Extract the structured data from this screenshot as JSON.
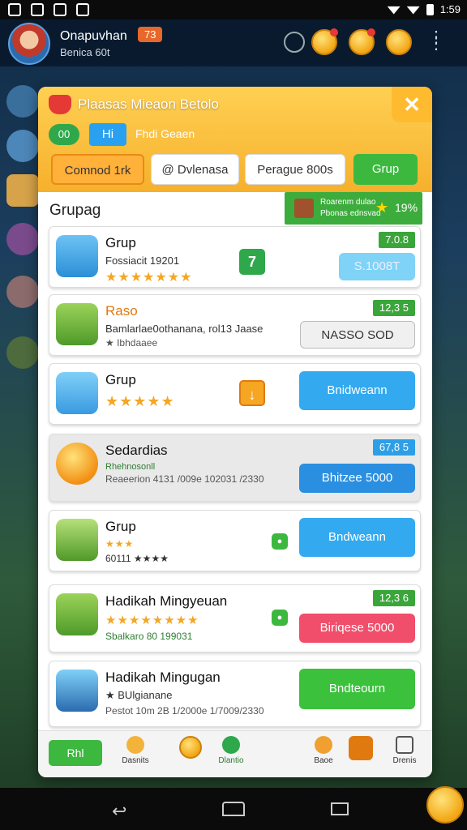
{
  "status_bar": {
    "time": "1:59"
  },
  "profile": {
    "name": "Onapuvhan",
    "level": "73",
    "subtitle": "Benica 60t"
  },
  "modal": {
    "title": "Plaasas Mieaon Betolo",
    "close_label": "✕",
    "pill_green": "00",
    "pill_blue": "Hi",
    "subtitle": "Fhdi Geaen",
    "tabs": [
      "Comnod 1rk",
      "@ Dvlenasa",
      "Perague 800s",
      "Grup"
    ],
    "section_title": "Grupag",
    "promo": {
      "line1": "Roarenm dulao",
      "line2": "Pbonas ednsvad",
      "value": "19%"
    }
  },
  "rows": [
    {
      "title": "Grup",
      "line1": "Fossiacit 19201",
      "line2": "★★★★★★★",
      "value": "7.0.8",
      "badge": "7",
      "button": "S.1008T"
    },
    {
      "title": "Raso",
      "line1": "Bamlarlae0othanana, rol13 Jaase",
      "line2": "★ Ibhdaaee",
      "value": "12,3 5",
      "button": "NASSO SOD"
    },
    {
      "title": "Grup",
      "line1": "★★★★★",
      "line2": "",
      "value": "",
      "badge": "↓",
      "button": "Bnidweann"
    },
    {
      "title": "Sedardias",
      "line1": "Rhehnosonll",
      "line2": "Reaeerion 4131 /009e 102031 /2330",
      "value": "67,8 5",
      "button": "Bhitzee 5000"
    },
    {
      "title": "Grup",
      "line1": "★★★",
      "line2": "60111 ★★★★",
      "value": "",
      "button": "Bndweann"
    },
    {
      "title": "Hadikah Mingyeuan",
      "line1": "★★★★★★★★",
      "line2": "Sbalkaro 80 199031",
      "value": "12,3 6",
      "button": "Biriqese 5000"
    },
    {
      "title": "Hadikah Mingugan",
      "line1": "★ BUlgianane",
      "line2": "Pestot 10m 2B 1/2000e 1/7009/2330",
      "value": "",
      "button": "Bndteourn"
    }
  ],
  "bottom_nav": {
    "primary": "Rhl",
    "item1": "Dasnits",
    "item2": "Dlantio",
    "item3": "Baoe",
    "item4": "Drenis"
  },
  "colors": {
    "accent_orange": "#f6b02c",
    "green": "#3cb83f",
    "blue": "#33aaf0",
    "red": "#f04e6a"
  }
}
